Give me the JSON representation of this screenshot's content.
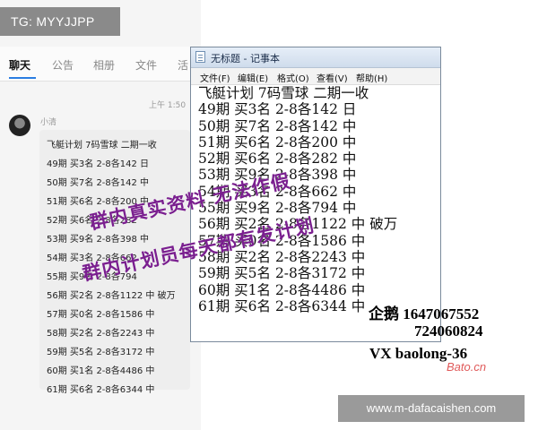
{
  "overlay": {
    "tg_label": "TG: MYYJJPP",
    "watermark_url": "www.m-dafacaishen.com",
    "logo_text": "Bato.cn"
  },
  "chat": {
    "tabs": [
      "聊天",
      "公告",
      "相册",
      "文件",
      "活"
    ],
    "message_time": "上午 1:50",
    "sender": "小清",
    "lines": [
      "飞艇计划  7码雪球  二期一收",
      "49期 买3名 2-8各142 日",
      "50期 买7名 2-8各142 中",
      "51期 买6名 2-8各200 中",
      "52期 买6名 2-8各282",
      "53期 买9名 2-8各398 中",
      "54期 买3名 2-8各662",
      "55期 买9名 2-8各794",
      "56期 买2名 2-8各1122 中 破万",
      "57期 买0名 2-8各1586 中",
      "58期 买2名 2-8各2243 中",
      "59期 买5名 2-8各3172 中",
      "60期 买1名 2-8各4486 中",
      "61期 买6名 2-8各6344 中"
    ]
  },
  "notepad": {
    "title": "无标题 - 记事本",
    "menu": [
      "文件(F)",
      "编辑(E)",
      "格式(O)",
      "查看(V)",
      "帮助(H)"
    ],
    "lines": [
      "飞艇计划  7码雪球  二期一收",
      "49期 买3名 2-8各142 日",
      "50期 买7名 2-8各142 中",
      "51期 买6名 2-8各200 中",
      "52期 买6名 2-8各282 中",
      "53期 买9名 2-8各398 中",
      "54期 买3名 2-8各662 中",
      "55期 买9名 2-8各794 中",
      "56期 买2名 2-8各1122 中  破万",
      "57期 买0名 2-8各1586 中",
      "58期 买2名 2-8各2243 中",
      "59期 买5名 2-8各3172 中",
      "60期 买1名 2-8各4486 中",
      "61期 买6名 2-8各6344 中"
    ]
  },
  "stamps": {
    "line1": "群内真实资料 无法作假",
    "line2": "群内计划员每天都有发计划"
  },
  "contact": {
    "qq": "企鹅 1647067552",
    "qq2": "724060824",
    "wechat": "VX baolong-36"
  }
}
